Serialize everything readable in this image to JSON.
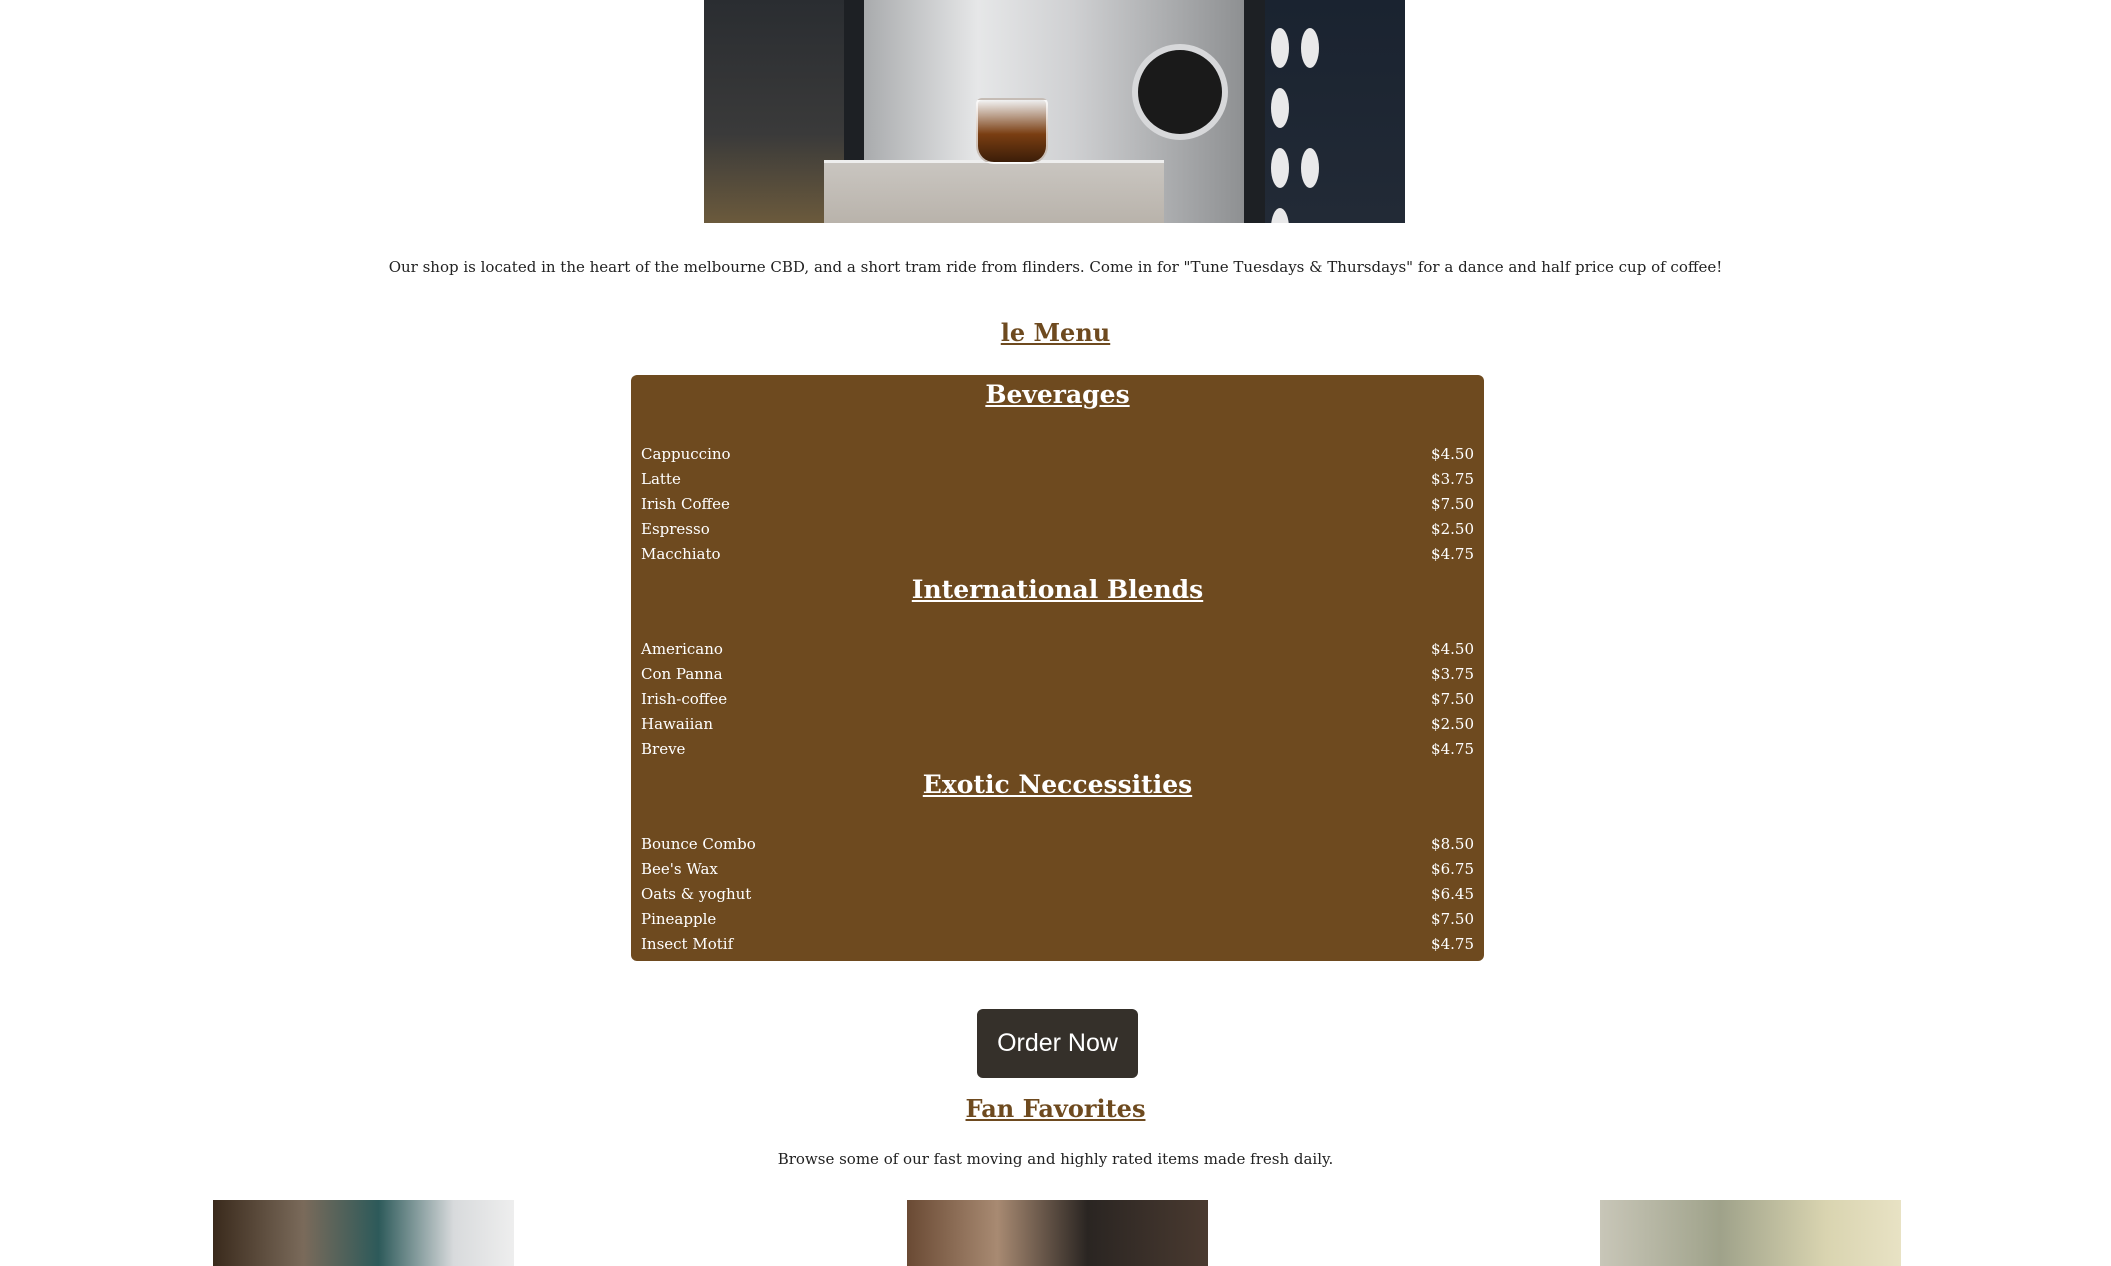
{
  "hero": {
    "image_alt": "espresso machine"
  },
  "intro": {
    "text": "Our shop is located in the heart of the melbourne CBD, and a short tram ride from flinders. Come in for \"Tune Tuesdays & Thursdays\" for a dance and half price cup of coffee!"
  },
  "menu": {
    "heading": "le Menu",
    "sections": [
      {
        "title": "Beverages",
        "items": [
          {
            "name": "Cappuccino",
            "price": "$4.50"
          },
          {
            "name": "Latte",
            "price": "$3.75"
          },
          {
            "name": "Irish Coffee",
            "price": "$7.50"
          },
          {
            "name": "Espresso",
            "price": "$2.50"
          },
          {
            "name": "Macchiato",
            "price": "$4.75"
          }
        ]
      },
      {
        "title": "International Blends",
        "items": [
          {
            "name": "Americano",
            "price": "$4.50"
          },
          {
            "name": "Con Panna",
            "price": "$3.75"
          },
          {
            "name": "Irish-coffee",
            "price": "$7.50"
          },
          {
            "name": "Hawaiian",
            "price": "$2.50"
          },
          {
            "name": "Breve",
            "price": "$4.75"
          }
        ]
      },
      {
        "title": "Exotic Neccessities",
        "items": [
          {
            "name": "Bounce Combo",
            "price": "$8.50"
          },
          {
            "name": "Bee's Wax",
            "price": "$6.75"
          },
          {
            "name": "Oats & yoghut",
            "price": "$6.45"
          },
          {
            "name": "Pineapple",
            "price": "$7.50"
          },
          {
            "name": "Insect Motif",
            "price": "$4.75"
          }
        ]
      }
    ]
  },
  "order": {
    "label": "Order Now"
  },
  "favorites": {
    "heading": "Fan Favorites",
    "text": "Browse some of our fast moving and highly rated items made fresh daily."
  },
  "colors": {
    "menu_board": "#6e4a1f",
    "heading_brown": "#6e4a1f",
    "button_dark": "#35302a"
  }
}
